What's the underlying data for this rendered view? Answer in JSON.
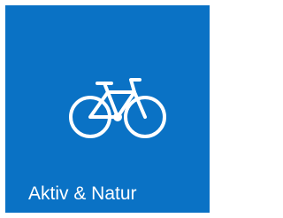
{
  "tile": {
    "label": "Aktiv & Natur",
    "icon": "bicycle-icon",
    "background_color": "#0a72c5",
    "text_color": "#ffffff"
  }
}
